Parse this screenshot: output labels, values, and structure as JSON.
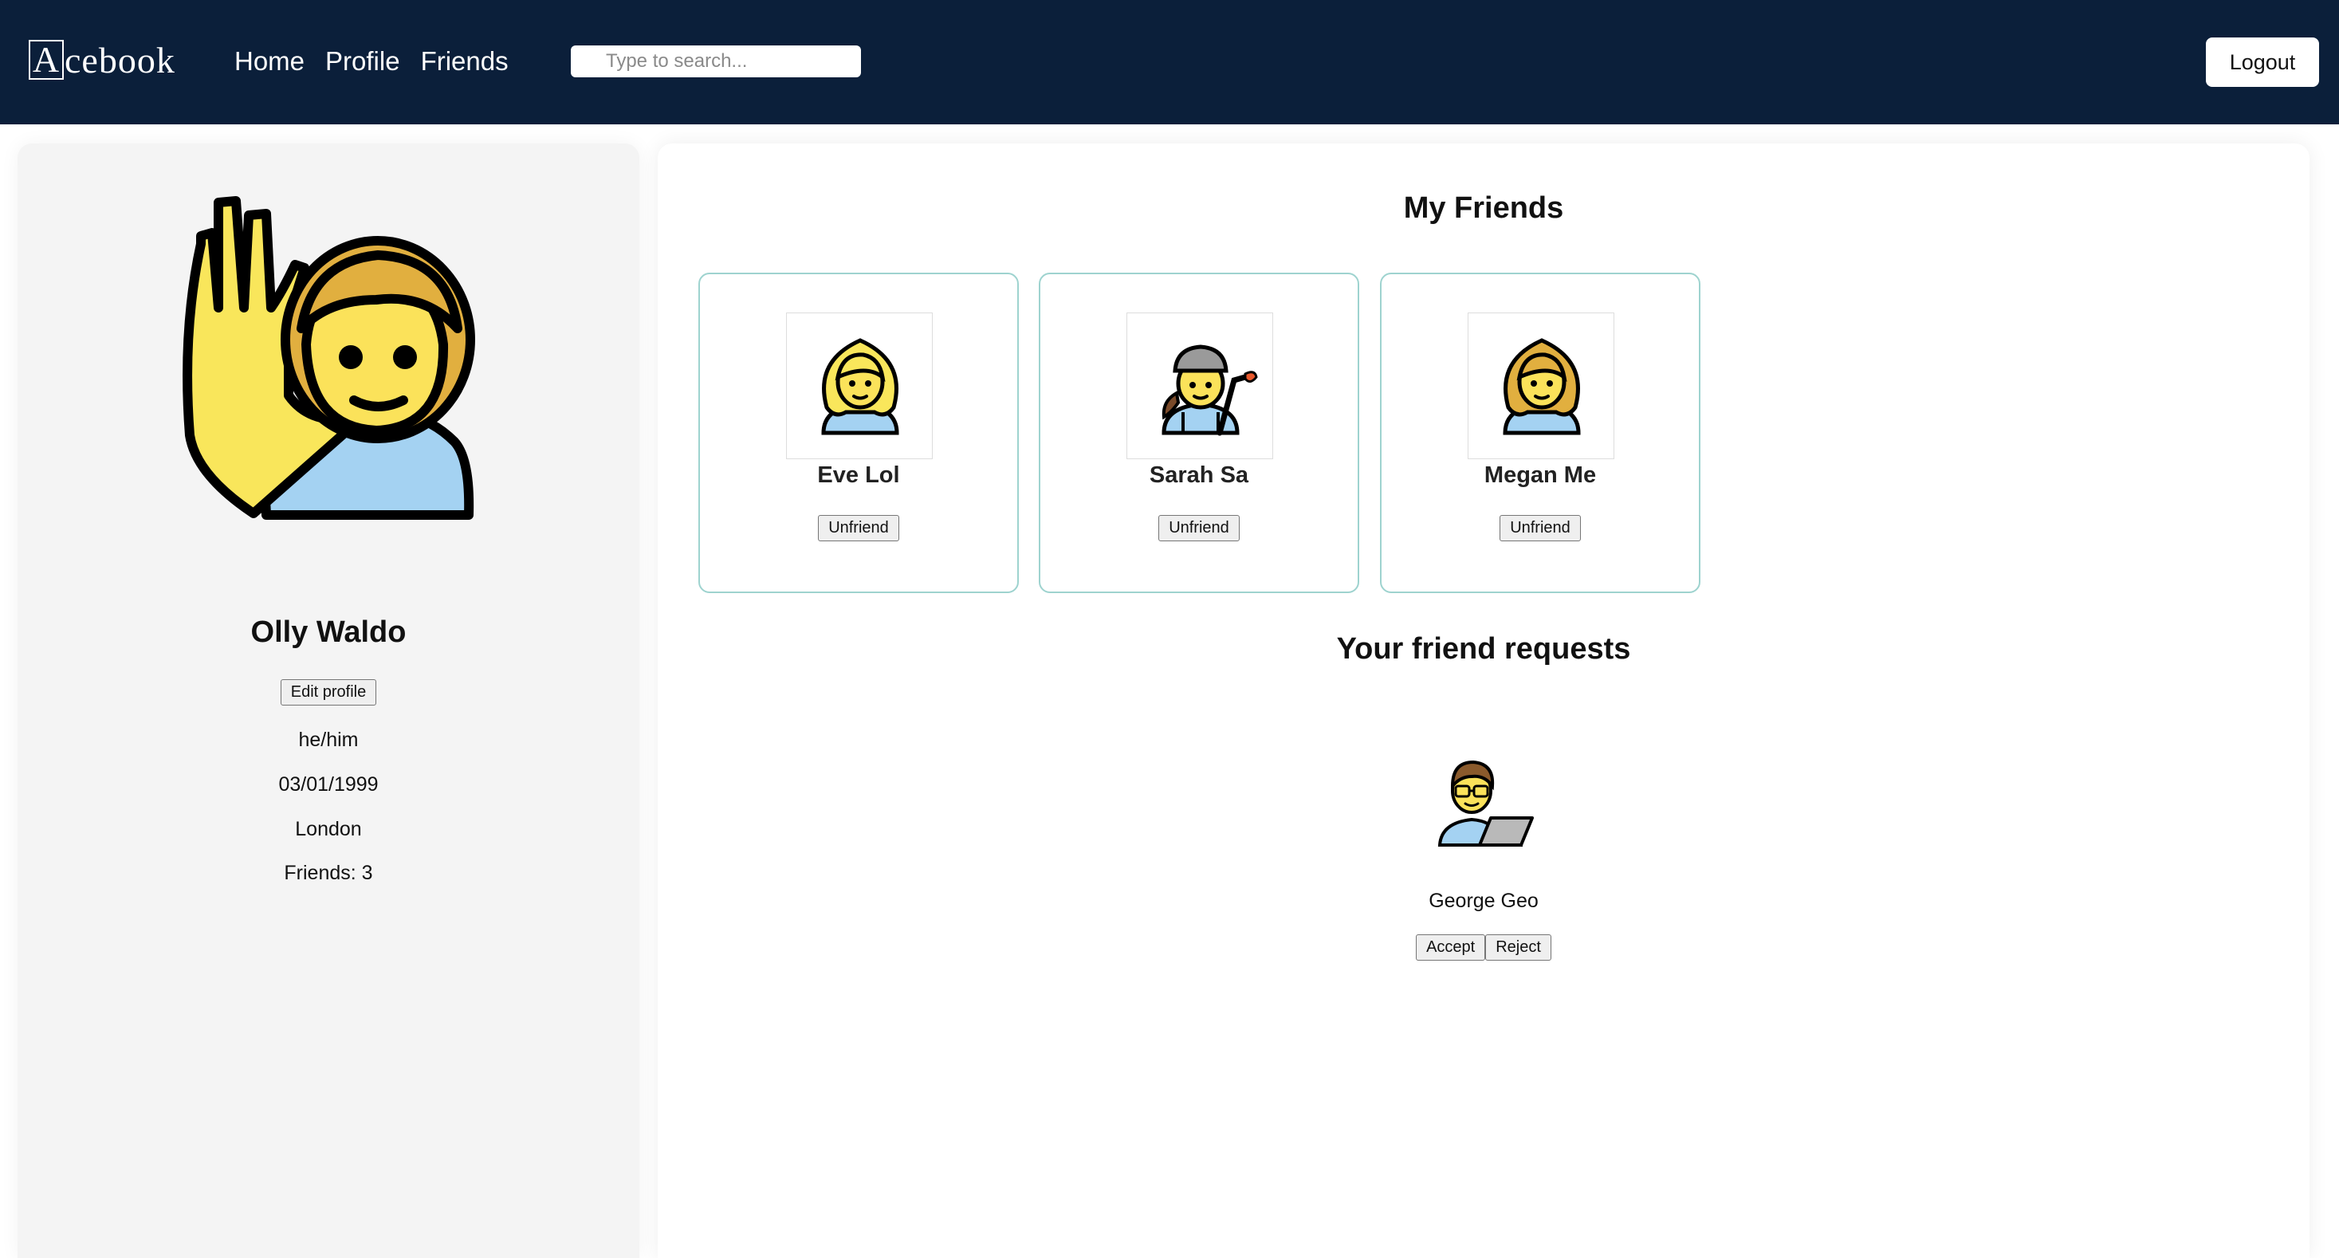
{
  "app": {
    "logo_first_letter": "A",
    "logo_rest": "cebook"
  },
  "nav": {
    "links": [
      "Home",
      "Profile",
      "Friends"
    ],
    "search_placeholder": "Type to search...",
    "logout_label": "Logout"
  },
  "profile": {
    "name": "Olly Waldo",
    "edit_label": "Edit profile",
    "pronouns": "he/him",
    "birthday": "03/01/1999",
    "location": "London",
    "friends_count": "Friends: 3",
    "avatar_icon": "person-raising-hand-icon"
  },
  "friends_section": {
    "title": "My Friends",
    "friends": [
      {
        "name": "Eve Lol",
        "button": "Unfriend",
        "avatar_icon": "woman-blond-hair-icon"
      },
      {
        "name": "Sarah Sa",
        "button": "Unfriend",
        "avatar_icon": "woman-factory-worker-icon"
      },
      {
        "name": "Megan Me",
        "button": "Unfriend",
        "avatar_icon": "woman-icon"
      }
    ]
  },
  "requests_section": {
    "title": "Your friend requests",
    "requests": [
      {
        "name": "George Geo",
        "accept_label": "Accept",
        "reject_label": "Reject",
        "avatar_icon": "man-technologist-icon"
      }
    ]
  },
  "colors": {
    "navbar": "#0b1f3a",
    "card_border": "#9ed3cf",
    "panel_bg": "#f4f4f4"
  }
}
